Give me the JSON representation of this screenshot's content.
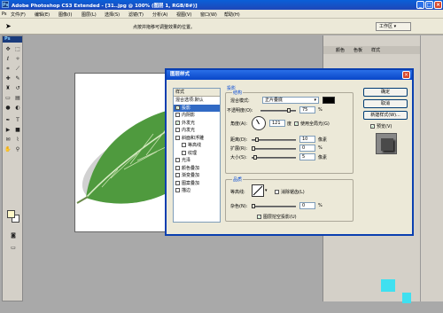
{
  "app": {
    "title": "Adobe Photoshop CS3 Extended - [31..jpg @ 100% (图层 1, RGB/8#)]"
  },
  "menu": [
    "文件(F)",
    "编辑(E)",
    "图像(I)",
    "图层(L)",
    "选择(S)",
    "滤镜(T)",
    "分析(A)",
    "视图(V)",
    "窗口(W)",
    "帮助(H)"
  ],
  "options": {
    "hint": "点按并拖移可调整效果的位置。",
    "workspace": "工作区 ▾"
  },
  "panel": {
    "tabs": [
      "颜色",
      "色板",
      "样式"
    ]
  },
  "dialog": {
    "title": "图层样式",
    "styles_header": "样式",
    "style_items": [
      {
        "label": "混合选项:默认",
        "checkbox": false,
        "checked": false,
        "indent": false,
        "selected": false
      },
      {
        "label": "投影",
        "checkbox": true,
        "checked": true,
        "indent": false,
        "selected": true
      },
      {
        "label": "内阴影",
        "checkbox": true,
        "checked": false,
        "indent": false,
        "selected": false
      },
      {
        "label": "外发光",
        "checkbox": true,
        "checked": true,
        "indent": false,
        "selected": false
      },
      {
        "label": "内发光",
        "checkbox": true,
        "checked": false,
        "indent": false,
        "selected": false
      },
      {
        "label": "斜面和浮雕",
        "checkbox": true,
        "checked": false,
        "indent": false,
        "selected": false
      },
      {
        "label": "等高线",
        "checkbox": true,
        "checked": false,
        "indent": true,
        "selected": false
      },
      {
        "label": "纹理",
        "checkbox": true,
        "checked": false,
        "indent": true,
        "selected": false
      },
      {
        "label": "光泽",
        "checkbox": true,
        "checked": false,
        "indent": false,
        "selected": false
      },
      {
        "label": "颜色叠加",
        "checkbox": true,
        "checked": false,
        "indent": false,
        "selected": false
      },
      {
        "label": "渐变叠加",
        "checkbox": true,
        "checked": false,
        "indent": false,
        "selected": false
      },
      {
        "label": "图案叠加",
        "checkbox": true,
        "checked": false,
        "indent": false,
        "selected": false
      },
      {
        "label": "描边",
        "checkbox": true,
        "checked": false,
        "indent": false,
        "selected": false
      }
    ],
    "section_title": "投影",
    "structure": {
      "title": "结构",
      "blend_mode_label": "混合模式:",
      "blend_mode": "正片叠底",
      "shadow_color": "#000000",
      "opacity_label": "不透明度(O):",
      "opacity": "75",
      "opacity_unit": "%",
      "angle_label": "角度(A):",
      "angle": "121",
      "angle_unit": "度",
      "global_light_label": "使用全局光(G)",
      "global_light_checked": true,
      "distance_label": "距离(D):",
      "distance": "10",
      "distance_unit": "像素",
      "spread_label": "扩展(R):",
      "spread": "0",
      "spread_unit": "%",
      "size_label": "大小(S):",
      "size": "5",
      "size_unit": "像素"
    },
    "quality": {
      "title": "品质",
      "contour_label": "等高线:",
      "antialias_label": "消除锯齿(L)",
      "antialias_checked": false,
      "noise_label": "杂色(N):",
      "noise": "0",
      "noise_unit": "%",
      "knockout_label": "图层挖空投影(U)",
      "knockout_checked": true
    },
    "buttons": {
      "ok": "确定",
      "cancel": "取消",
      "new_style": "新建样式(W)...",
      "preview_label": "预览(V)",
      "preview_checked": true
    }
  }
}
